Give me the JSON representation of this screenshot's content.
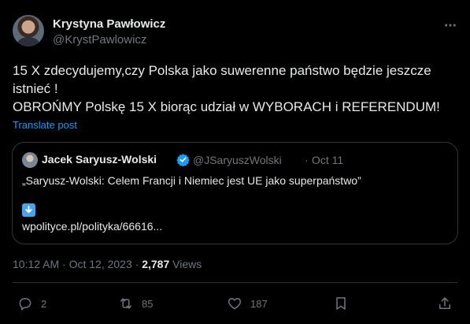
{
  "author": {
    "name": "Krystyna Pawłowicz",
    "handle": "@KrystPawlowicz"
  },
  "post": {
    "lines": [
      "15 X zdecydujemy,czy Polska jako suwerenne państwo będzie jeszcze",
      "istnieć !",
      "OBROŃMY Polskę 15 X biorąc udział w WYBORACH i REFERENDUM!"
    ],
    "translate": "Translate post"
  },
  "quote": {
    "name": "Jacek Saryusz-Wolski",
    "handle": "@JSaryuszWolski",
    "separator": "·",
    "date": "Oct 11",
    "text": "„Saryusz-Wolski: Celem Francji i Niemiec jest UE jako superpaństwo”",
    "link": "wpolityce.pl/polityka/66616..."
  },
  "meta": {
    "timestamp": "10:12 AM · Oct 12, 2023 · ",
    "views_count": "2,787",
    "views_label": " Views"
  },
  "actions": {
    "replies": "2",
    "reposts": "85",
    "likes": "187"
  },
  "colors": {
    "background": "#000000",
    "text": "#e7e9ea",
    "muted": "#71767b",
    "link": "#1d9bf0",
    "border": "#333639",
    "verified": "#1d9bf0"
  },
  "icons": [
    "more-icon",
    "verified-icon",
    "arrow-down-icon",
    "reply-icon",
    "repost-icon",
    "like-icon",
    "bookmark-icon",
    "share-icon"
  ]
}
